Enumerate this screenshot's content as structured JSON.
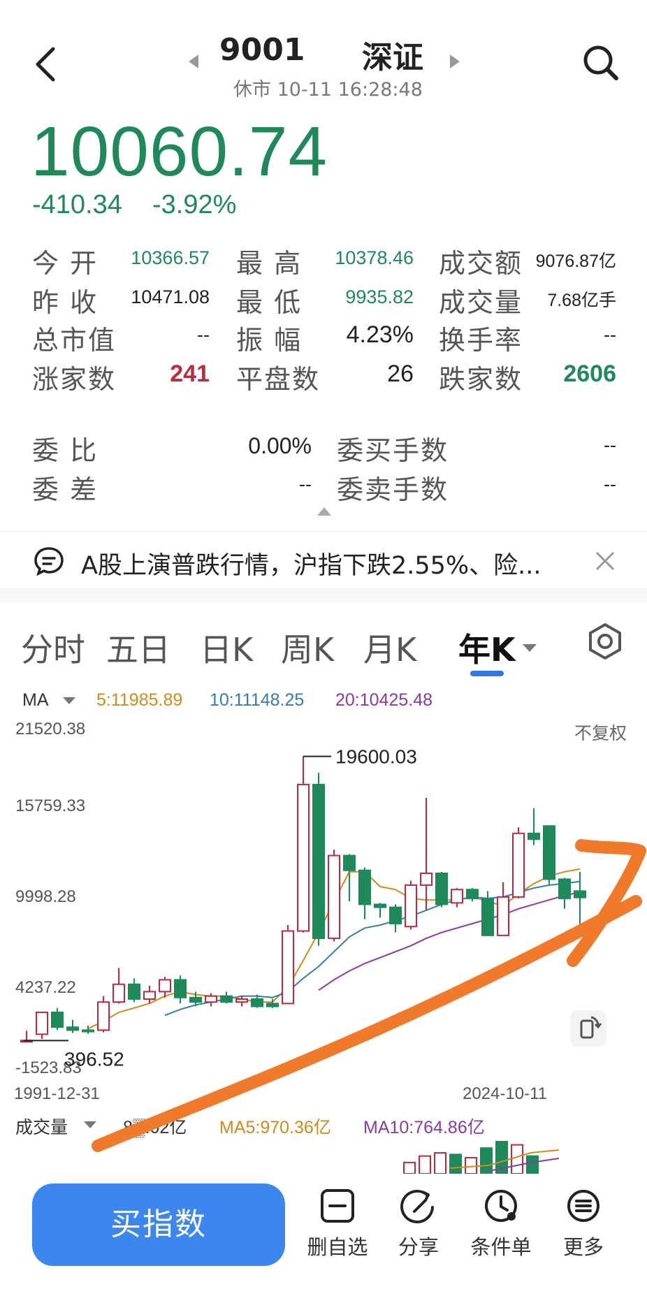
{
  "header": {
    "code": "9001",
    "market": "深证",
    "status": "休市  10-11 16:28:48"
  },
  "quote": {
    "price": "10060.74",
    "change": "-410.34",
    "change_pct": "-3.92%"
  },
  "stats": {
    "open_label": "今  开",
    "open": "10366.57",
    "high_label": "最  高",
    "high": "10378.46",
    "turnover_label": "成交额",
    "turnover": "9076.87亿",
    "prev_label": "昨  收",
    "prev": "10471.08",
    "low_label": "最  低",
    "low": "9935.82",
    "volume_label": "成交量",
    "volume": "7.68亿手",
    "mcap_label": "总市值",
    "mcap": "--",
    "amp_label": "振  幅",
    "amp": "4.23%",
    "turnrate_label": "换手率",
    "turnrate": "--",
    "up_label": "涨家数",
    "up": "241",
    "flat_label": "平盘数",
    "flat": "26",
    "down_label": "跌家数",
    "down": "2606",
    "ratio_label": "委  比",
    "ratio": "0.00%",
    "bidlots_label": "委买手数",
    "bidlots": "--",
    "diff_label": "委  差",
    "diff": "--",
    "asklots_label": "委卖手数",
    "asklots": "--"
  },
  "news": {
    "text": "A股上演普跌行情，沪指下跌2.55%、险..."
  },
  "tabs": [
    "分时",
    "五日",
    "日K",
    "周K",
    "月K",
    "年K"
  ],
  "active_tab": "年K",
  "ma": {
    "label": "MA",
    "ma5": "5:11985.89",
    "ma10": "10:11148.25",
    "ma20": "20:10425.48"
  },
  "chart_axis": {
    "y_top": "21520.38",
    "y_2": "15759.33",
    "y_3": "9998.28",
    "y_4": "4237.22",
    "y_bottom": "-1523.83",
    "no_adjust": "不复权",
    "date_start": "1991-12-31",
    "date_end": "2024-10-11",
    "high_label": "19600.03",
    "low_label": "396.52"
  },
  "volume": {
    "label": "成交量",
    "value": "8▒.02亿",
    "ma5": "MA5:970.36亿",
    "ma10": "MA10:764.86亿"
  },
  "actions": {
    "buy": "买指数",
    "remove": "删自选",
    "share": "分享",
    "condition": "条件单",
    "more": "更多"
  },
  "colors": {
    "up": "#c0283c",
    "down": "#1e8a5a",
    "ma5": "#d08a18",
    "ma10": "#2f7fa8",
    "ma20": "#8a3aa3",
    "accent": "#3c86ef",
    "annotation": "#f07a2a"
  },
  "chart_data": {
    "type": "candlestick",
    "x_range": [
      "1991-12-31",
      "2024-10-11"
    ],
    "ylim": [
      -1523.83,
      21520.38
    ],
    "candles": [
      {
        "o": 396.52,
        "h": 1060,
        "l": 396.52,
        "c": 400
      },
      {
        "o": 820,
        "h": 2000,
        "l": 500,
        "c": 2300
      },
      {
        "o": 2300,
        "h": 2600,
        "l": 1100,
        "c": 1300
      },
      {
        "o": 1300,
        "h": 1800,
        "l": 900,
        "c": 1100
      },
      {
        "o": 1100,
        "h": 1400,
        "l": 850,
        "c": 1000
      },
      {
        "o": 1100,
        "h": 3400,
        "l": 950,
        "c": 3000
      },
      {
        "o": 3000,
        "h": 5300,
        "l": 2900,
        "c": 4200
      },
      {
        "o": 4200,
        "h": 4600,
        "l": 3000,
        "c": 3200
      },
      {
        "o": 3200,
        "h": 4100,
        "l": 2900,
        "c": 3700
      },
      {
        "o": 3700,
        "h": 4700,
        "l": 3300,
        "c": 4500
      },
      {
        "o": 4500,
        "h": 4800,
        "l": 2900,
        "c": 3300
      },
      {
        "o": 3300,
        "h": 3700,
        "l": 2700,
        "c": 3000
      },
      {
        "o": 3000,
        "h": 3600,
        "l": 2700,
        "c": 3400
      },
      {
        "o": 3400,
        "h": 3700,
        "l": 2900,
        "c": 3000
      },
      {
        "o": 3000,
        "h": 3400,
        "l": 2700,
        "c": 3200
      },
      {
        "o": 3200,
        "h": 3500,
        "l": 2600,
        "c": 2700
      },
      {
        "o": 2900,
        "h": 3200,
        "l": 2600,
        "c": 2700
      },
      {
        "o": 2900,
        "h": 8200,
        "l": 2900,
        "c": 7800
      },
      {
        "o": 7800,
        "h": 19600.03,
        "l": 7700,
        "c": 17700
      },
      {
        "o": 17700,
        "h": 18500,
        "l": 6800,
        "c": 7300
      },
      {
        "o": 7300,
        "h": 13300,
        "l": 7100,
        "c": 12900
      },
      {
        "o": 12900,
        "h": 13000,
        "l": 9800,
        "c": 11900
      },
      {
        "o": 11900,
        "h": 12100,
        "l": 8600,
        "c": 9600
      },
      {
        "o": 9600,
        "h": 9700,
        "l": 8700,
        "c": 9400
      },
      {
        "o": 9400,
        "h": 9600,
        "l": 7700,
        "c": 8300
      },
      {
        "o": 8100,
        "h": 11200,
        "l": 7900,
        "c": 10900
      },
      {
        "o": 10900,
        "h": 16800,
        "l": 9200,
        "c": 11700
      },
      {
        "o": 11700,
        "h": 11800,
        "l": 9400,
        "c": 9600
      },
      {
        "o": 9700,
        "h": 10700,
        "l": 9400,
        "c": 10600
      },
      {
        "o": 10600,
        "h": 10700,
        "l": 9800,
        "c": 10000
      },
      {
        "o": 10000,
        "h": 10500,
        "l": 7500,
        "c": 7500
      },
      {
        "o": 7500,
        "h": 11100,
        "l": 7500,
        "c": 10100
      },
      {
        "o": 10100,
        "h": 14800,
        "l": 10000,
        "c": 14400
      },
      {
        "o": 14400,
        "h": 16100,
        "l": 13600,
        "c": 14000
      },
      {
        "o": 14900,
        "h": 14900,
        "l": 10900,
        "c": 11300
      },
      {
        "o": 11300,
        "h": 11400,
        "l": 9300,
        "c": 10000
      },
      {
        "o": 10500,
        "h": 11800,
        "l": 8200,
        "c": 10060.74
      }
    ],
    "ma_series": [
      {
        "name": "MA5",
        "values": [
          null,
          null,
          null,
          null,
          1200,
          1700,
          2300,
          2600,
          2900,
          3400,
          3700,
          3500,
          3400,
          3400,
          3200,
          3000,
          3000,
          4000,
          5800,
          7700,
          9800,
          11800,
          11800,
          10800,
          10600,
          10000,
          9900,
          9900,
          9900,
          10100,
          9800,
          9500,
          10300,
          11000,
          11500,
          11800,
          11985.89
        ]
      },
      {
        "name": "MA10",
        "values": [
          null,
          null,
          null,
          null,
          null,
          null,
          null,
          null,
          null,
          2100,
          2500,
          2800,
          3000,
          3200,
          3400,
          3400,
          3300,
          3700,
          4600,
          5400,
          6400,
          7400,
          8000,
          8200,
          8500,
          8800,
          9200,
          9600,
          9900,
          10100,
          10000,
          10100,
          10400,
          10700,
          10900,
          11000,
          11148.25
        ]
      },
      {
        "name": "MA20",
        "values": [
          null,
          null,
          null,
          null,
          null,
          null,
          null,
          null,
          null,
          null,
          null,
          null,
          null,
          null,
          null,
          null,
          null,
          null,
          null,
          3800,
          4500,
          5100,
          5600,
          6000,
          6400,
          6800,
          7300,
          7700,
          8000,
          8300,
          8600,
          8900,
          9300,
          9600,
          9900,
          10200,
          10425.48
        ]
      }
    ],
    "volume_bars": [
      {
        "v": 0.35,
        "up": true
      },
      {
        "v": 0.55,
        "up": true
      },
      {
        "v": 0.65,
        "up": true
      },
      {
        "v": 0.6,
        "up": false
      },
      {
        "v": 0.5,
        "up": true
      },
      {
        "v": 0.8,
        "up": false
      },
      {
        "v": 1.0,
        "up": false
      },
      {
        "v": 0.9,
        "up": true
      },
      {
        "v": 0.55,
        "up": false
      }
    ]
  }
}
